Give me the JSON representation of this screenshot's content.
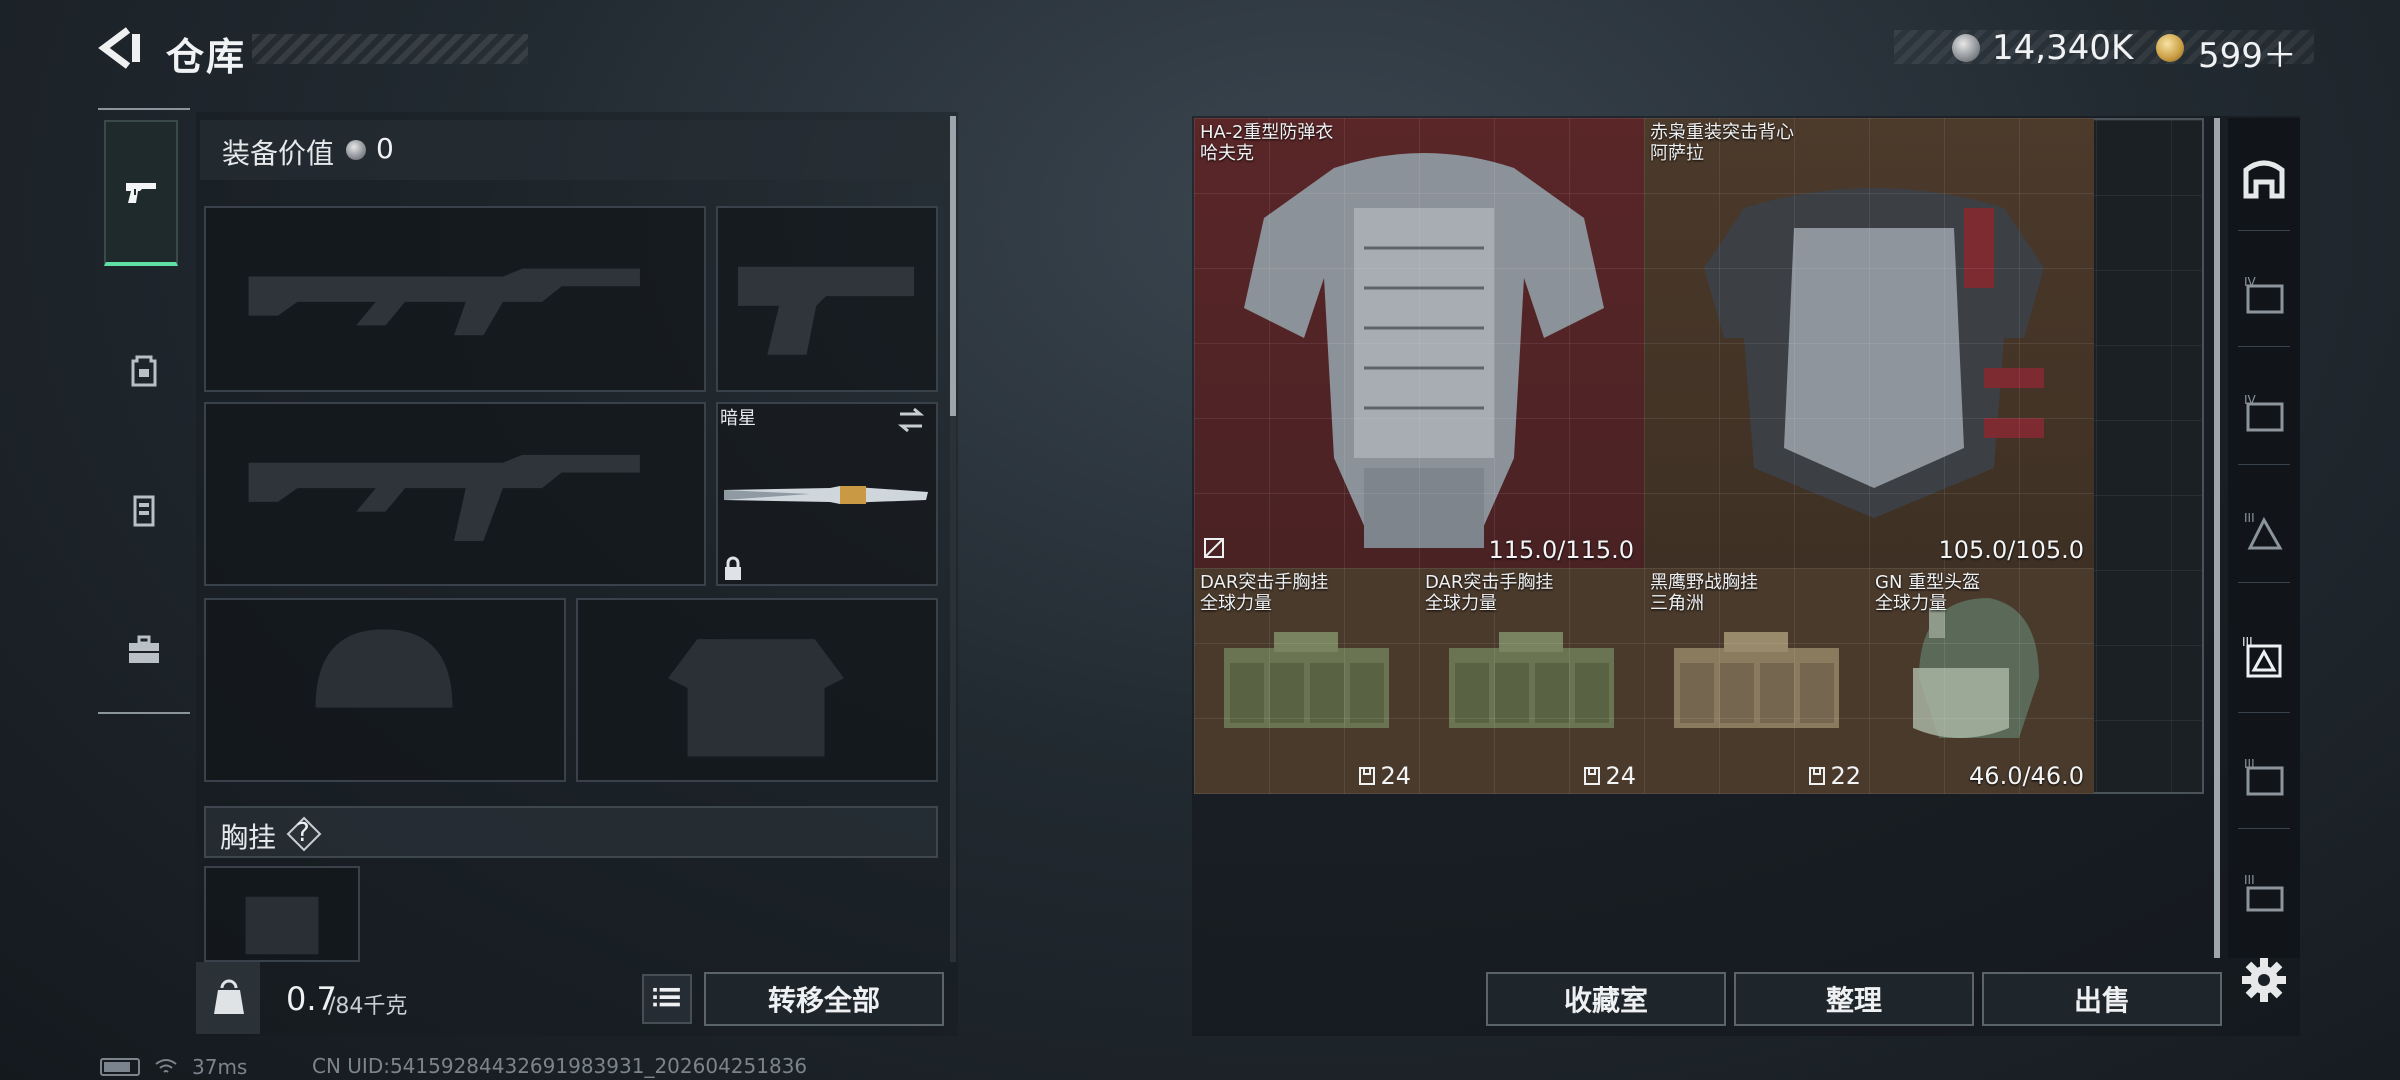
{
  "header": {
    "title": "仓库",
    "currency_silver": "14,340K",
    "currency_gold": "599＋"
  },
  "left_rail": {
    "tabs": [
      "weapons",
      "backpack",
      "chest-rig",
      "toolbox"
    ]
  },
  "equipment": {
    "value_label": "装备价值",
    "value": "0",
    "melee_name": "暗星",
    "chest_rig_label": "胸挂",
    "chest_rig_help": "?"
  },
  "bottom_left": {
    "weight": "0.7",
    "weight_max": "/84千克",
    "transfer_all": "转移全部"
  },
  "status": {
    "ping": "37ms",
    "uid": "CN UID:54159284432691983931_202604251836"
  },
  "stash": {
    "items": [
      {
        "name": "HA-2重型防弹衣",
        "brand": "哈夫克",
        "durability": "115.0/115.0"
      },
      {
        "name": "赤枭重装突击背心",
        "brand": "阿萨拉",
        "durability": "105.0/105.0"
      },
      {
        "name": "DAR突击手胸挂",
        "brand": "全球力量",
        "capacity": "24"
      },
      {
        "name": "DAR突击手胸挂",
        "brand": "全球力量",
        "capacity": "24"
      },
      {
        "name": "黑鹰野战胸挂",
        "brand": "三角洲",
        "capacity": "22"
      },
      {
        "name": "GN 重型头盔",
        "brand": "全球力量",
        "durability": "46.0/46.0"
      }
    ],
    "buttons": {
      "collection": "收藏室",
      "organize": "整理",
      "sell": "出售"
    }
  },
  "right_rail": {
    "tabs": [
      "all-items",
      "tier-iv-armor",
      "tier-iv-rig",
      "tier-iii-helmet",
      "tier-iii-armor",
      "tier-iii-rig",
      "tier-iii-other"
    ]
  },
  "colors": {
    "accent_green": "#5fe0a4",
    "rarity_red": "#5a2628",
    "rarity_orange": "#4a3a2c"
  }
}
